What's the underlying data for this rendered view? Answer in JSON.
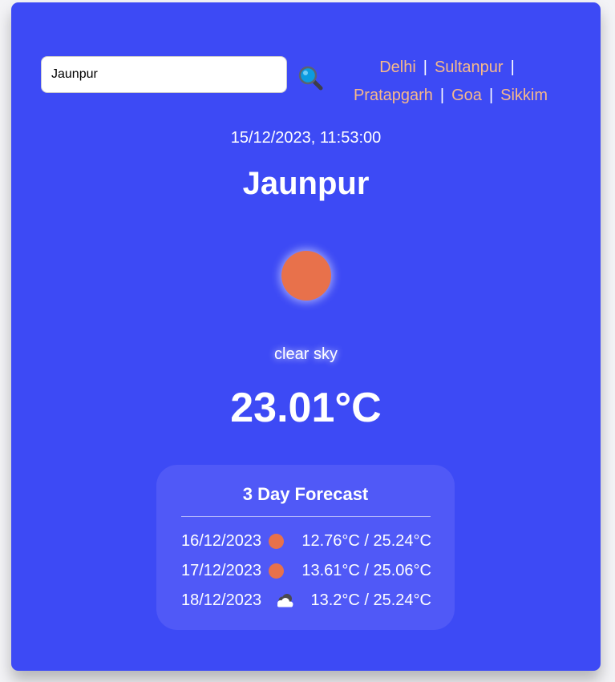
{
  "search": {
    "value": "Jaunpur",
    "button_icon": "magnifier-icon"
  },
  "cities": {
    "items": [
      "Delhi",
      "Sultanpur",
      "Pratapgarh",
      "Goa",
      "Sikkim"
    ],
    "separator": "|"
  },
  "current": {
    "datetime": "15/12/2023, 11:53:00",
    "city": "Jaunpur",
    "icon": "sun-icon",
    "condition": "clear sky",
    "temperature": "23.01°C"
  },
  "forecast": {
    "title": "3 Day Forecast",
    "days": [
      {
        "date": "16/12/2023",
        "icon": "sun-icon",
        "range": "12.76°C / 25.24°C"
      },
      {
        "date": "17/12/2023",
        "icon": "sun-icon",
        "range": "13.61°C / 25.06°C"
      },
      {
        "date": "18/12/2023",
        "icon": "cloud-icon",
        "range": "13.2°C / 25.24°C"
      }
    ]
  },
  "colors": {
    "card_background": "#3d4af5",
    "forecast_background": "#5059f7",
    "city_link": "#f7b98a",
    "sun": "#e8714b",
    "page_background": "#f3f3f6"
  }
}
